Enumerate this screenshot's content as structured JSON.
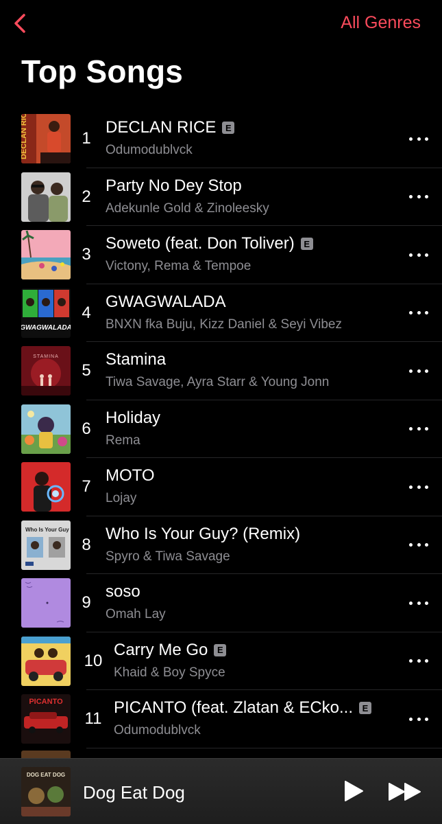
{
  "header": {
    "back_icon": "chevron-left-icon",
    "genres_label": "All Genres",
    "title": "Top Songs"
  },
  "colors": {
    "accent": "#fa4b5c",
    "secondary_text": "#8e8e93",
    "background": "#000000"
  },
  "songs": [
    {
      "rank": "1",
      "title": "DECLAN RICE",
      "artist": "Odumodublvck",
      "explicit": true
    },
    {
      "rank": "2",
      "title": "Party No Dey Stop",
      "artist": "Adekunle Gold & Zinoleesky",
      "explicit": false
    },
    {
      "rank": "3",
      "title": "Soweto (feat. Don Toliver)",
      "artist": "Victony, Rema & Tempoe",
      "explicit": true
    },
    {
      "rank": "4",
      "title": "GWAGWALADA",
      "artist": "BNXN fka Buju, Kizz Daniel & Seyi Vibez",
      "explicit": false
    },
    {
      "rank": "5",
      "title": "Stamina",
      "artist": "Tiwa Savage, Ayra Starr & Young Jonn",
      "explicit": false
    },
    {
      "rank": "6",
      "title": "Holiday",
      "artist": "Rema",
      "explicit": false
    },
    {
      "rank": "7",
      "title": "MOTO",
      "artist": "Lojay",
      "explicit": false
    },
    {
      "rank": "8",
      "title": "Who Is Your Guy? (Remix)",
      "artist": "Spyro & Tiwa Savage",
      "explicit": false
    },
    {
      "rank": "9",
      "title": "soso",
      "artist": "Omah Lay",
      "explicit": false
    },
    {
      "rank": "10",
      "title": "Carry Me Go",
      "artist": "Khaid & Boy Spyce",
      "explicit": true
    },
    {
      "rank": "11",
      "title": "PICANTO (feat. Zlatan & ECko...",
      "artist": "Odumodublvck",
      "explicit": true
    }
  ],
  "explicit_badge": "E",
  "artwork_text": {
    "declan_rice": "DECLAN RICE",
    "gwagwalada": "GWAGWALADA",
    "stamina": "STAMINA",
    "who_is_your_guy": "Who Is Your Guy",
    "picanto": "PICANTO",
    "dog_eat_dog": "DOG EAT DOG"
  },
  "now_playing": {
    "title": "Dog Eat Dog",
    "play_icon": "play-icon",
    "forward_icon": "forward-icon"
  }
}
